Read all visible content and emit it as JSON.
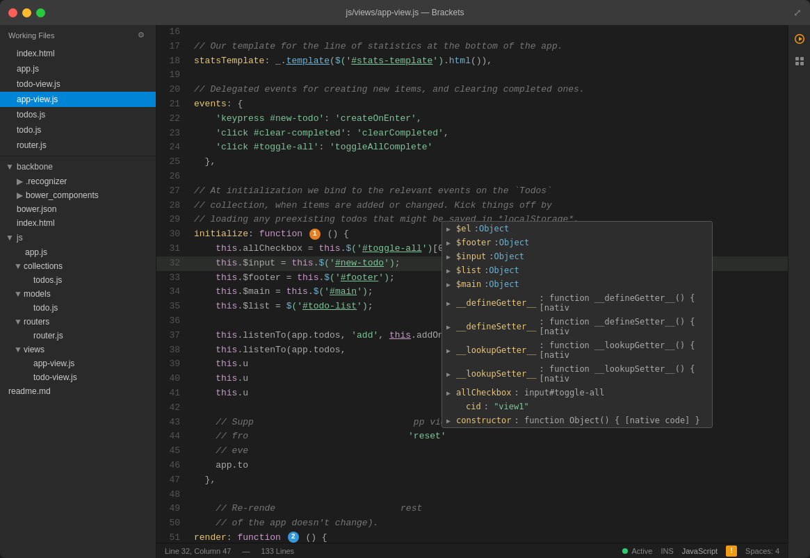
{
  "window": {
    "title": "js/views/app-view.js — Brackets"
  },
  "titlebar": {
    "title": "js/views/app-view.js — Brackets"
  },
  "sidebar": {
    "working_files_label": "Working Files",
    "gear_icon": "⚙",
    "files": [
      {
        "name": "index.html",
        "active": false
      },
      {
        "name": "app.js",
        "active": false
      },
      {
        "name": "todo-view.js",
        "active": false
      },
      {
        "name": "app-view.js",
        "active": true
      },
      {
        "name": "todos.js",
        "active": false
      },
      {
        "name": "todo.js",
        "active": false
      },
      {
        "name": "router.js",
        "active": false
      }
    ],
    "tree": {
      "backbone": {
        "label": "backbone",
        "children": [
          {
            "label": ".recognizer",
            "indent": 1
          },
          {
            "label": "bower_components",
            "indent": 1
          },
          {
            "label": "bower.json",
            "indent": 1
          },
          {
            "label": "index.html",
            "indent": 1
          }
        ]
      },
      "js": {
        "label": "js",
        "children": [
          {
            "label": "app.js",
            "indent": 2
          },
          {
            "label": "collections",
            "children": [
              {
                "label": "todos.js",
                "indent": 3
              }
            ]
          },
          {
            "label": "models",
            "children": [
              {
                "label": "todo.js",
                "indent": 3
              }
            ]
          },
          {
            "label": "routers",
            "children": [
              {
                "label": "router.js",
                "indent": 3
              }
            ]
          },
          {
            "label": "views",
            "children": [
              {
                "label": "app-view.js",
                "indent": 3
              },
              {
                "label": "todo-view.js",
                "indent": 3
              }
            ]
          }
        ]
      },
      "readme": {
        "label": "readme.md"
      }
    }
  },
  "statusbar": {
    "line_col": "Line 32, Column 47",
    "lines": "133 Lines",
    "active_label": "Active",
    "ins_label": "INS",
    "language_label": "JavaScript",
    "spaces_label": "Spaces: 4"
  },
  "autocomplete": {
    "items": [
      {
        "key": "$el",
        "colon": ":",
        "type": "Object"
      },
      {
        "key": "$footer",
        "colon": ":",
        "type": "Object"
      },
      {
        "key": "$input",
        "colon": ":",
        "type": "Object"
      },
      {
        "key": "$list",
        "colon": ":",
        "type": "Object"
      },
      {
        "key": "$main",
        "colon": ":",
        "type": "Object"
      },
      {
        "key": "__defineGetter__",
        "colon": ":",
        "val": "function __defineGetter__() { [nativ"
      },
      {
        "key": "__defineSetter__",
        "colon": ":",
        "val": "function __defineSetter__() { [nativ"
      },
      {
        "key": "__lookupGetter__",
        "colon": ":",
        "val": "function __lookupGetter__() { [nativ"
      },
      {
        "key": "__lookupSetter__",
        "colon": ":",
        "val": "function __lookupSetter__() { [nativ"
      },
      {
        "key": "allCheckbox",
        "colon": ":",
        "val": "input#toggle-all"
      },
      {
        "key": "cid",
        "colon": ":",
        "val": "\"view1\""
      },
      {
        "key": "constructor",
        "colon": ":",
        "val": "function Object() { [native code] }"
      }
    ]
  }
}
